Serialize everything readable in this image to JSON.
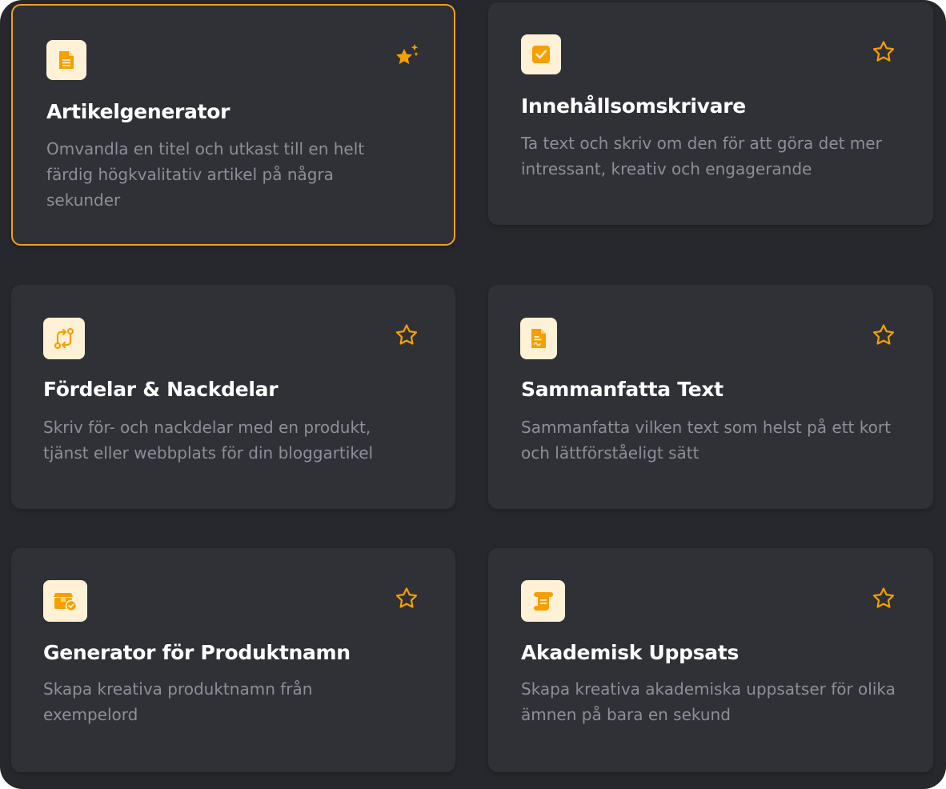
{
  "colors": {
    "background": "#27282d",
    "card": "#303137",
    "accent": "#f0a020",
    "icon_tile": "#fff1d6",
    "title": "#ffffff",
    "description": "#8c8f9b"
  },
  "cards": [
    {
      "icon": "document-icon",
      "title": "Artikelgenerator",
      "description": "Omvandla en titel och utkast till en helt färdig högkvalitativ artikel på några sekunder",
      "favorite_icon": "sparkle-star-icon",
      "selected": true
    },
    {
      "icon": "checkbox-icon",
      "title": "Innehållsomskrivare",
      "description": "Ta text och skriv om den för att göra det mer intressant, kreativ och engagerande",
      "favorite_icon": "star-outline-icon",
      "selected": false
    },
    {
      "icon": "compare-arrows-icon",
      "title": "Fördelar & Nackdelar",
      "description": "Skriv för- och nackdelar med en produkt, tjänst eller webbplats för din bloggartikel",
      "favorite_icon": "star-outline-icon",
      "selected": false
    },
    {
      "icon": "summary-document-icon",
      "title": "Sammanfatta Text",
      "description": "Sammanfatta vilken text som helst på ett kort och lättförståeligt sätt",
      "favorite_icon": "star-outline-icon",
      "selected": false
    },
    {
      "icon": "product-box-icon",
      "title": "Generator för Produktnamn",
      "description": "Skapa kreativa produktnamn från exempelord",
      "favorite_icon": "star-outline-icon",
      "selected": false
    },
    {
      "icon": "scroll-icon",
      "title": "Akademisk Uppsats",
      "description": "Skapa kreativa akademiska uppsatser för olika ämnen på bara en sekund",
      "favorite_icon": "star-outline-icon",
      "selected": false
    }
  ]
}
